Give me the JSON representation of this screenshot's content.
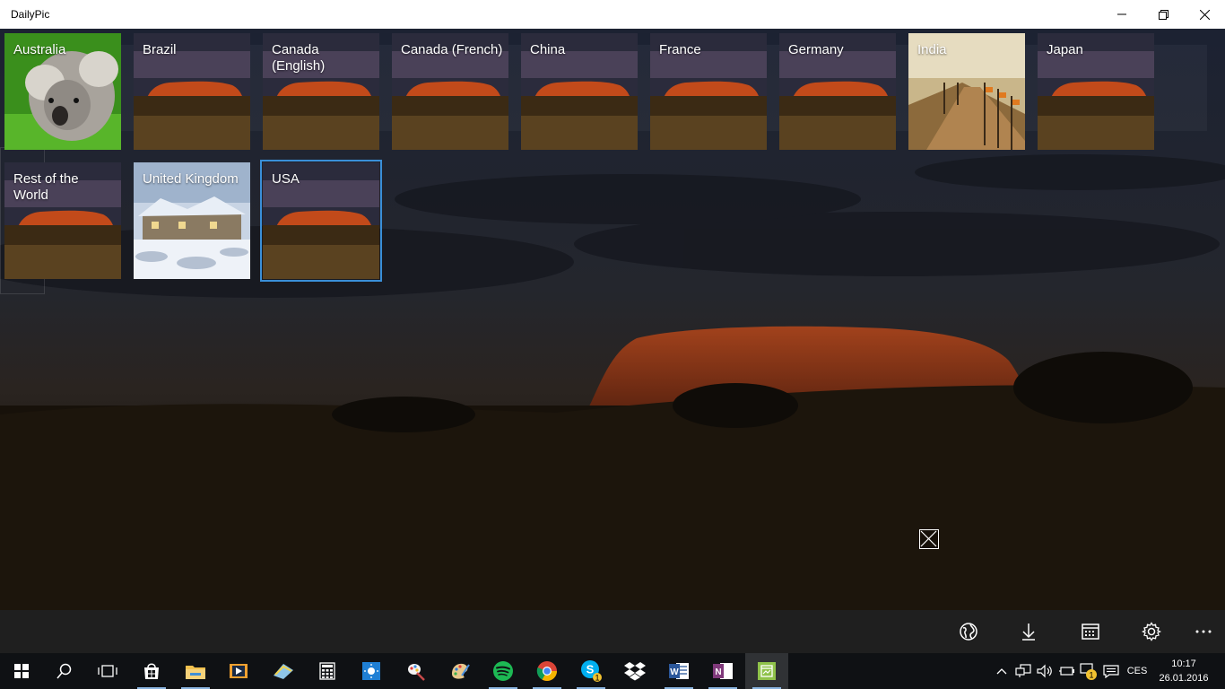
{
  "window": {
    "title": "DailyPic"
  },
  "tiles": [
    {
      "label": "Australia",
      "image": "koala",
      "selected": false
    },
    {
      "label": "Brazil",
      "image": "uluru",
      "selected": false
    },
    {
      "label": "Canada (English)",
      "image": "uluru",
      "selected": false
    },
    {
      "label": "Canada (French)",
      "image": "uluru",
      "selected": false
    },
    {
      "label": "China",
      "image": "uluru",
      "selected": false
    },
    {
      "label": "France",
      "image": "uluru",
      "selected": false
    },
    {
      "label": "Germany",
      "image": "uluru",
      "selected": false
    },
    {
      "label": "India",
      "image": "parade-flags",
      "selected": false
    },
    {
      "label": "Japan",
      "image": "uluru",
      "selected": false
    },
    {
      "label": "Rest of the World",
      "image": "uluru",
      "selected": false
    },
    {
      "label": "United Kingdom",
      "image": "snowy-cottage",
      "selected": false
    },
    {
      "label": "USA",
      "image": "uluru",
      "selected": true
    }
  ],
  "command_bar": {
    "items": [
      "globe-icon",
      "download-icon",
      "calendar-icon",
      "settings-icon",
      "more-icon"
    ]
  },
  "taskbar": {
    "apps": [
      "start-icon",
      "search-icon",
      "task-view-icon",
      "store-icon",
      "file-explorer-icon",
      "media-player-icon",
      "photos-icon",
      "calculator-icon",
      "weather-icon",
      "paint-icon",
      "fresh-paint-icon",
      "spotify-icon",
      "chrome-icon",
      "skype-icon",
      "dropbox-icon",
      "word-icon",
      "onenote-icon",
      "dailypic-icon"
    ],
    "skype_badge": "1",
    "tray_badge": "1",
    "language": "CES",
    "time": "10:17",
    "date": "26.01.2016"
  },
  "colors": {
    "accent": "#3a8fd8",
    "titlebar": "#ffffff",
    "commandbar": "#1f1f1f",
    "taskbar": "#0f1114"
  }
}
